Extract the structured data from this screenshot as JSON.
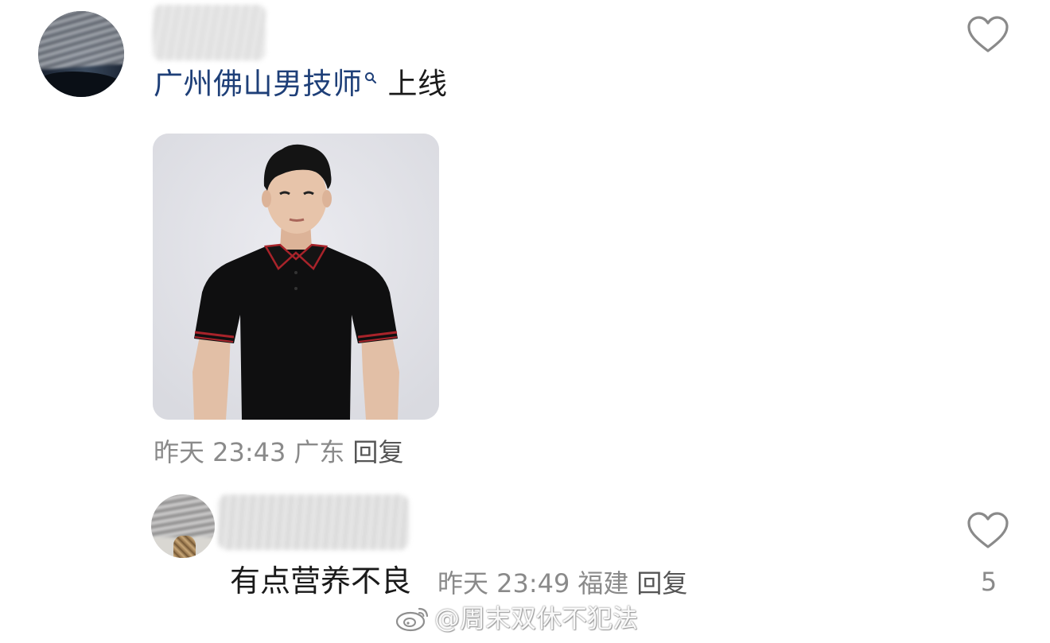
{
  "top_comment": {
    "link_text": "广州佛山男技师",
    "text_suffix": "上线",
    "time": "昨天 23:43",
    "location": "广东",
    "reply_label": "回复"
  },
  "reply_comment": {
    "text": "有点营养不良",
    "time": "昨天 23:49",
    "location": "福建",
    "reply_label": "回复",
    "like_count": "5"
  },
  "watermark": {
    "text": "@周末双休不犯法"
  },
  "colors": {
    "link": "#1e3f78",
    "meta": "#8a8a8a",
    "icon": "#8a8a8a"
  },
  "icons": {
    "like": "heart-outline-icon",
    "search": "search-icon",
    "weibo": "weibo-logo-icon"
  }
}
